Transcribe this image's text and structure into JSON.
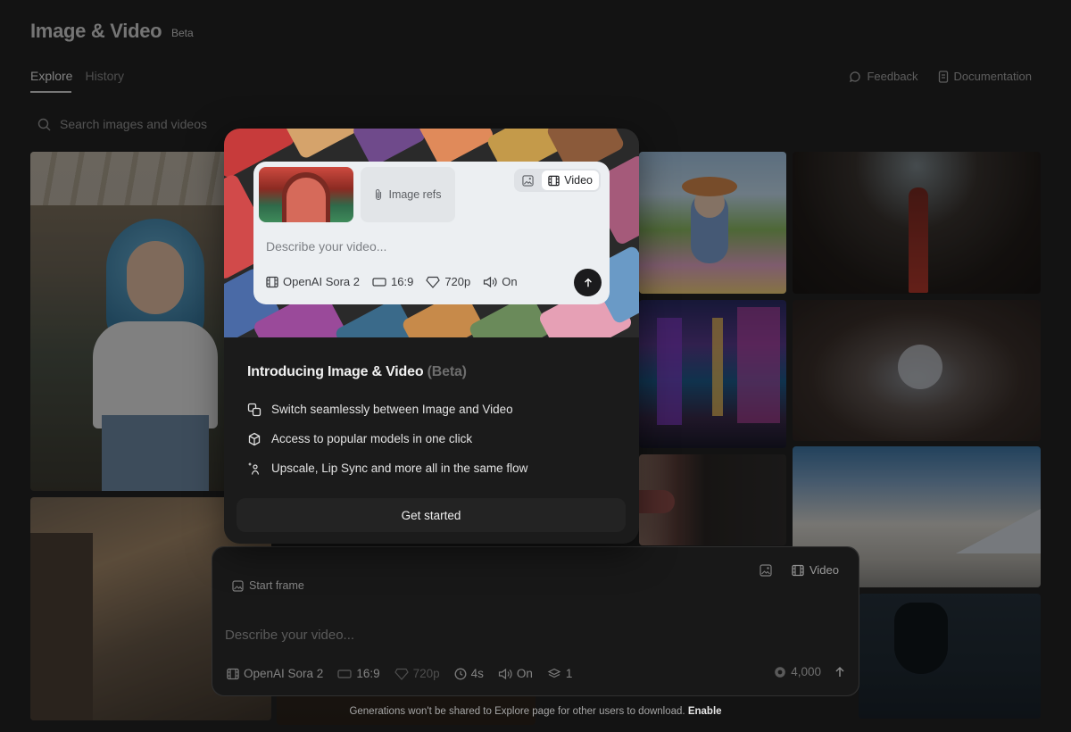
{
  "header": {
    "title": "Image & Video",
    "beta": "Beta",
    "tabs": [
      {
        "label": "Explore"
      },
      {
        "label": "History"
      }
    ],
    "feedback": "Feedback",
    "documentation": "Documentation"
  },
  "search": {
    "placeholder": "Search images and videos"
  },
  "modal": {
    "preview": {
      "image_refs": "Image refs",
      "video_label": "Video",
      "placeholder": "Describe your video...",
      "model": "OpenAI Sora 2",
      "ratio": "16:9",
      "quality": "720p",
      "audio": "On"
    },
    "title": "Introducing Image & Video",
    "title_suffix": "(Beta)",
    "features": [
      {
        "label": "Switch seamlessly between Image and Video",
        "icon": "switch-icon"
      },
      {
        "label": "Access to popular models in one click",
        "icon": "cube-icon"
      },
      {
        "label": "Upscale, Lip Sync and more all in the same flow",
        "icon": "sparkle-person-icon"
      }
    ],
    "cta": "Get started"
  },
  "composer": {
    "start_frame": "Start frame",
    "video_label": "Video",
    "placeholder": "Describe your video...",
    "model": "OpenAI Sora 2",
    "ratio": "16:9",
    "quality": "720p",
    "duration": "4s",
    "audio": "On",
    "count": "1",
    "credits": "4,000"
  },
  "footer": {
    "note": "Generations won't be shared to Explore page for other users to download.",
    "enable": "Enable"
  }
}
